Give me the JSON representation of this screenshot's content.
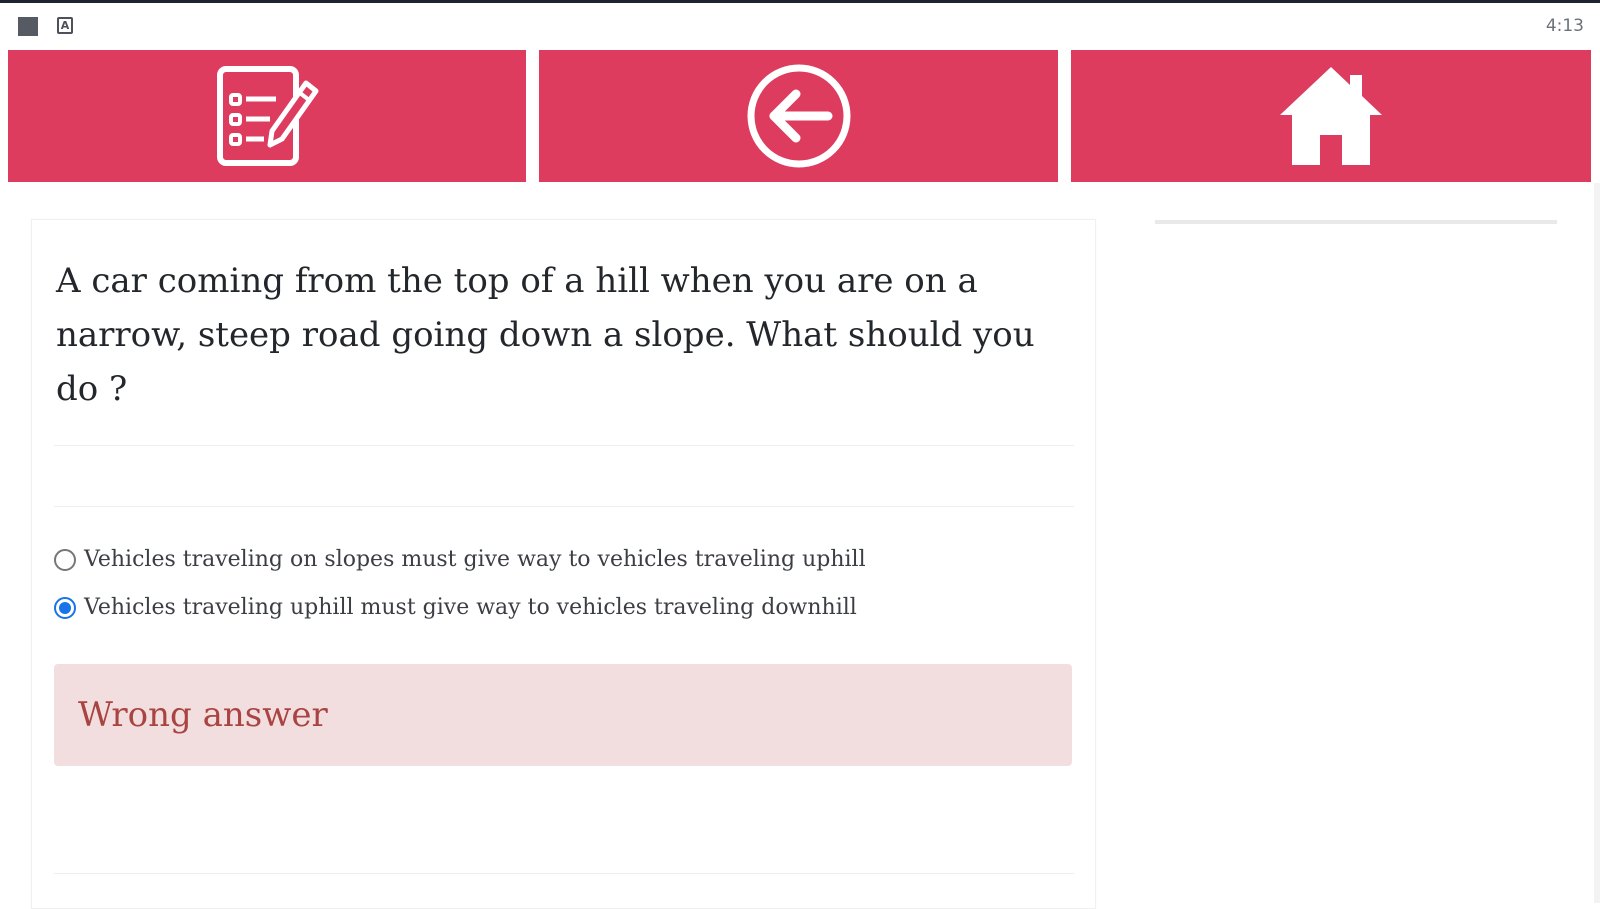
{
  "status_bar": {
    "time": "4:13",
    "a_icon_glyph": "A",
    "left_icons": [
      "square-icon",
      "a-badge-icon"
    ]
  },
  "toolbar": {
    "quiz_button": {
      "icon": "checklist-pencil-icon"
    },
    "back_button": {
      "icon": "arrow-left-circle-icon"
    },
    "home_button": {
      "icon": "home-icon"
    },
    "color": "#dd3c5f"
  },
  "question": {
    "text": "A car coming from the top of a hill when you are on a narrow, steep road going down a slope. What should you do ?"
  },
  "options": [
    {
      "label": "Vehicles traveling on slopes must give way to vehicles traveling uphill",
      "selected": false
    },
    {
      "label": "Vehicles traveling uphill must give way to vehicles traveling downhill",
      "selected": true
    }
  ],
  "feedback": {
    "text": "Wrong answer",
    "color": "#a94442",
    "background": "#f2dede"
  }
}
